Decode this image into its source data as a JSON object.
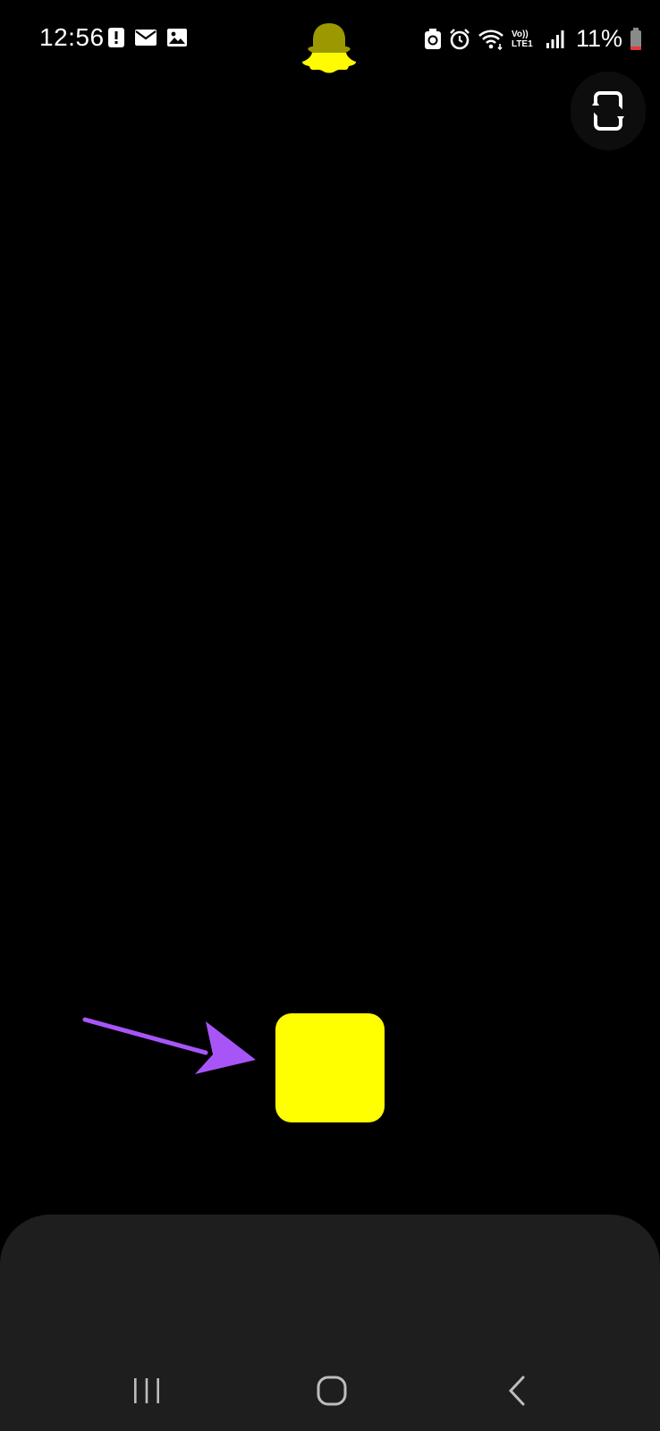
{
  "status_bar": {
    "time": "12:56",
    "left_icons": [
      "alert-icon",
      "mail-icon",
      "image-icon"
    ],
    "right_icons": [
      "battery-saver-icon",
      "alarm-icon",
      "wifi-icon",
      "volte-icon",
      "signal-icon",
      "battery-icon"
    ],
    "volte_label": "Vo)) LTE1",
    "battery_percent": "11%"
  },
  "header": {
    "logo_icon": "snapchat-ghost-icon",
    "flip_camera_icon": "flip-camera-icon"
  },
  "capture": {
    "record_button_icon": "stop-record-square-icon",
    "annotation_icon": "pointer-arrow-icon"
  },
  "nav_bar": {
    "items": [
      "recent-apps-icon",
      "home-icon",
      "back-icon"
    ]
  },
  "colors": {
    "background": "#000000",
    "accent_yellow": "#FFFF00",
    "logo_yellow": "#FFFC00",
    "arrow_purple": "#A855F7",
    "panel": "#1E1E1E",
    "battery_low": "#E53935"
  }
}
